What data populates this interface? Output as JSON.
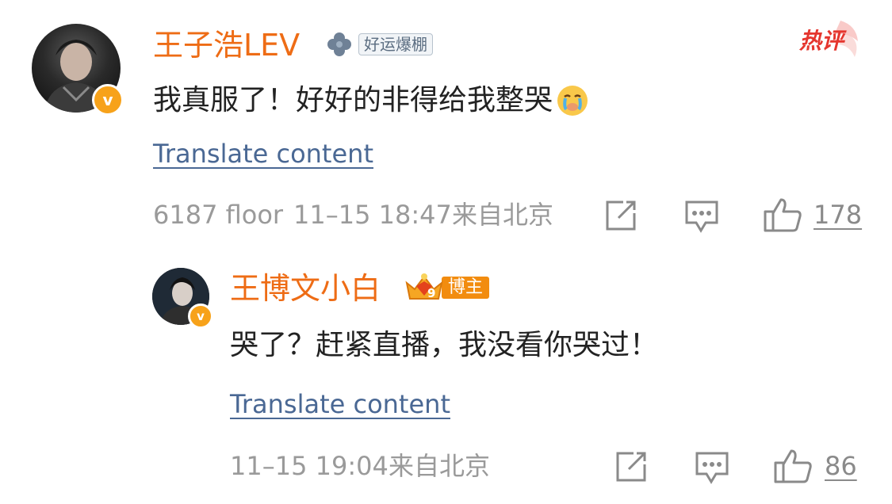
{
  "comment": {
    "username": "王子浩LEV",
    "badge_label": "好运爆棚",
    "hot_tag": "热评",
    "text": "我真服了！好好的非得给我整哭",
    "emoji": "crying-face",
    "translate_label": "Translate content",
    "floor": "6187 floor",
    "time": "11–15 18:47",
    "location": "来自北京",
    "like_count": "178",
    "verified_mark": "v"
  },
  "reply": {
    "username": "王博文小白",
    "badge_label": "博主",
    "badge_level": "9",
    "text": "哭了？赶紧直播，我没看你哭过！",
    "translate_label": "Translate content",
    "time": "11–15 19:04",
    "location": "来自北京",
    "like_count": "86",
    "verified_mark": "v"
  },
  "colors": {
    "username": "#ee6c15",
    "link": "#4a6894",
    "meta": "#9a9a9a",
    "verified": "#f7a21a",
    "hot": "#e5362e"
  }
}
